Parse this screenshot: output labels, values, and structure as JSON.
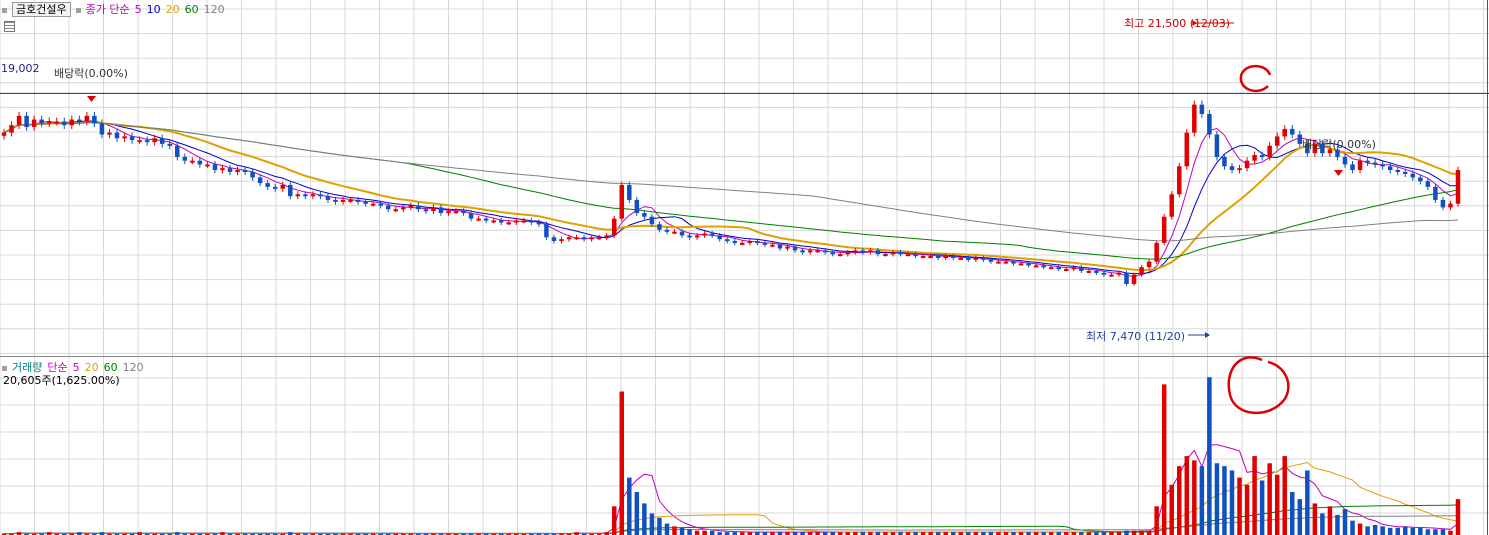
{
  "header": {
    "stock_name": "금호건설우",
    "ma_title": "종가 단순",
    "ma_periods": [
      "5",
      "10",
      "20",
      "60",
      "120"
    ],
    "ma_colors": [
      "#c000c0",
      "#0000cc",
      "#e0a000",
      "#008000",
      "#808080"
    ]
  },
  "price_panel": {
    "ref_price_label": "19,002",
    "dividend_label_1": "배당락(0.00%)",
    "dividend_label_2": "배당락(0.00%)",
    "high_label": "최고 21,500 (12/03)",
    "low_label": "최저 7,470 (11/20)"
  },
  "volume_panel": {
    "title": "거래량",
    "ma_title": "단순",
    "ma_periods": [
      "5",
      "20",
      "60",
      "120"
    ],
    "ma_colors": [
      "#c000c0",
      "#e0a000",
      "#008000",
      "#808080"
    ],
    "current_label": "20,605주(1,625.00%)"
  },
  "colors": {
    "up": "#e00000",
    "down": "#1050c0",
    "grid": "#d8d8d8",
    "ref_line": "#1f1f8f"
  },
  "chart_data": {
    "type": "candlestick",
    "price_axis": {
      "range": [
        5000,
        24000
      ],
      "reference_line": 19002
    },
    "high": {
      "value": 21500,
      "date": "12/03"
    },
    "low": {
      "value": 7470,
      "date": "11/20"
    },
    "moving_averages": [
      5,
      10,
      20,
      60,
      120
    ],
    "volume_moving_averages": [
      5,
      20,
      60,
      120
    ],
    "close_series": [
      16900,
      17300,
      17800,
      17200,
      17600,
      17400,
      17500,
      17500,
      17300,
      17600,
      17500,
      17800,
      17400,
      16800,
      16900,
      16600,
      16700,
      16500,
      16500,
      16400,
      16600,
      16300,
      16200,
      15600,
      15400,
      15400,
      15200,
      15200,
      14900,
      15000,
      14800,
      14900,
      14800,
      14500,
      14200,
      14000,
      13900,
      14100,
      13500,
      13600,
      13500,
      13600,
      13500,
      13300,
      13200,
      13300,
      13300,
      13200,
      13100,
      13100,
      13000,
      12800,
      12800,
      12900,
      13000,
      12800,
      12700,
      12900,
      12600,
      12700,
      12700,
      12600,
      12300,
      12300,
      12200,
      12200,
      12100,
      12100,
      12200,
      12200,
      12100,
      12000,
      11300,
      11100,
      11200,
      11300,
      11300,
      11200,
      11300,
      11300,
      11400,
      12300,
      14100,
      13300,
      12600,
      12400,
      12000,
      11700,
      11600,
      11600,
      11400,
      11300,
      11400,
      11500,
      11400,
      11200,
      11100,
      11000,
      11000,
      11100,
      11000,
      10900,
      10900,
      10700,
      10800,
      10600,
      10500,
      10600,
      10600,
      10500,
      10400,
      10400,
      10500,
      10600,
      10500,
      10600,
      10400,
      10400,
      10500,
      10400,
      10400,
      10300,
      10300,
      10300,
      10200,
      10300,
      10200,
      10200,
      10100,
      10200,
      10100,
      10000,
      10000,
      10000,
      9900,
      9900,
      9800,
      9800,
      9700,
      9700,
      9600,
      9600,
      9700,
      9500,
      9500,
      9400,
      9300,
      9300,
      9400,
      8800,
      9300,
      9700,
      10000,
      11000,
      12400,
      13600,
      15100,
      16900,
      18400,
      17900,
      16800,
      15600,
      15100,
      14900,
      15000,
      15400,
      15700,
      15600,
      16200,
      16700,
      17100,
      16800,
      16300,
      15800,
      16300,
      15800,
      16000,
      15600,
      15200,
      14900,
      15400,
      15300,
      15200,
      15100,
      14900,
      14800,
      14700,
      14500,
      14300,
      14000,
      13300,
      12900,
      13100,
      14900
    ],
    "volume_series": [
      0.01,
      0.01,
      0.02,
      0.01,
      0.01,
      0.01,
      0.02,
      0.01,
      0.01,
      0.01,
      0.02,
      0.01,
      0.01,
      0.02,
      0.01,
      0.01,
      0.01,
      0.01,
      0.02,
      0.01,
      0.01,
      0.01,
      0.01,
      0.02,
      0.01,
      0.01,
      0.01,
      0.01,
      0.01,
      0.02,
      0.01,
      0.01,
      0.01,
      0.01,
      0.01,
      0.01,
      0.01,
      0.01,
      0.02,
      0.01,
      0.01,
      0.01,
      0.01,
      0.01,
      0.01,
      0.01,
      0.01,
      0.01,
      0.01,
      0.01,
      0.01,
      0.01,
      0.01,
      0.01,
      0.01,
      0.01,
      0.01,
      0.01,
      0.01,
      0.01,
      0.01,
      0.01,
      0.01,
      0.01,
      0.01,
      0.01,
      0.01,
      0.01,
      0.01,
      0.01,
      0.01,
      0.01,
      0.01,
      0.01,
      0.01,
      0.01,
      0.02,
      0.01,
      0.01,
      0.01,
      0.02,
      0.2,
      1.0,
      0.4,
      0.3,
      0.22,
      0.15,
      0.12,
      0.08,
      0.06,
      0.05,
      0.04,
      0.03,
      0.03,
      0.03,
      0.02,
      0.02,
      0.02,
      0.02,
      0.02,
      0.02,
      0.02,
      0.02,
      0.02,
      0.02,
      0.02,
      0.02,
      0.02,
      0.02,
      0.02,
      0.02,
      0.02,
      0.02,
      0.02,
      0.02,
      0.02,
      0.02,
      0.02,
      0.02,
      0.02,
      0.02,
      0.02,
      0.02,
      0.02,
      0.02,
      0.02,
      0.02,
      0.02,
      0.02,
      0.02,
      0.02,
      0.02,
      0.02,
      0.02,
      0.02,
      0.02,
      0.02,
      0.02,
      0.02,
      0.02,
      0.02,
      0.02,
      0.02,
      0.02,
      0.02,
      0.02,
      0.02,
      0.02,
      0.02,
      0.03,
      0.03,
      0.03,
      0.03,
      0.2,
      1.05,
      0.35,
      0.48,
      0.55,
      0.52,
      0.48,
      1.1,
      0.5,
      0.48,
      0.45,
      0.4,
      0.35,
      0.55,
      0.38,
      0.5,
      0.42,
      0.55,
      0.3,
      0.25,
      0.45,
      0.22,
      0.15,
      0.2,
      0.14,
      0.18,
      0.1,
      0.08,
      0.06,
      0.07,
      0.06,
      0.05,
      0.05,
      0.06,
      0.05,
      0.05,
      0.04,
      0.04,
      0.04,
      0.03,
      0.25
    ]
  }
}
